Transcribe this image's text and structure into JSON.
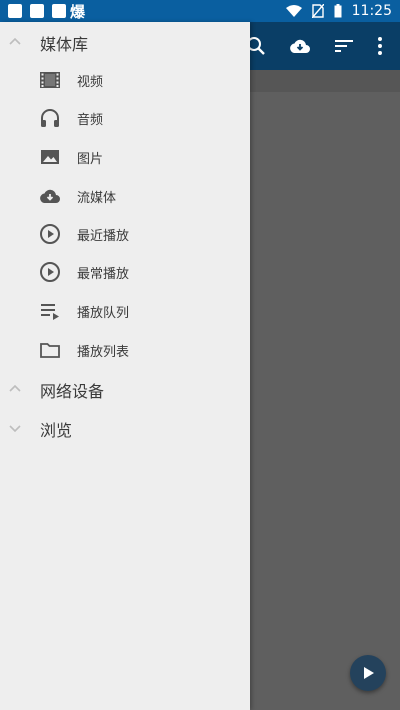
{
  "status_bar": {
    "time": "11:25",
    "notification_glyph": "爆",
    "icons": [
      "wifi-icon",
      "no-sim-icon",
      "battery-icon"
    ]
  },
  "drawer": {
    "sections": [
      {
        "label": "媒体库",
        "expanded": true,
        "items": [
          {
            "label": "视频",
            "icon": "film-icon"
          },
          {
            "label": "音频",
            "icon": "headphones-icon"
          },
          {
            "label": "图片",
            "icon": "image-icon"
          },
          {
            "label": "流媒体",
            "icon": "cloud-download-icon"
          },
          {
            "label": "最近播放",
            "icon": "play-circle-icon"
          },
          {
            "label": "最常播放",
            "icon": "play-circle-icon"
          },
          {
            "label": "播放队列",
            "icon": "playlist-play-icon"
          },
          {
            "label": "播放列表",
            "icon": "folder-icon"
          }
        ]
      },
      {
        "label": "网络设备",
        "expanded": true
      },
      {
        "label": "浏览",
        "expanded": false
      }
    ]
  },
  "appbar": {
    "actions": [
      "search-icon",
      "cloud-download-icon",
      "sort-icon",
      "more-vert-icon"
    ]
  },
  "colors": {
    "status_bar": "#0a5fa0",
    "appbar": "#0a3e66",
    "drawer_bg": "#eeeeee",
    "fab": "#24425c"
  }
}
